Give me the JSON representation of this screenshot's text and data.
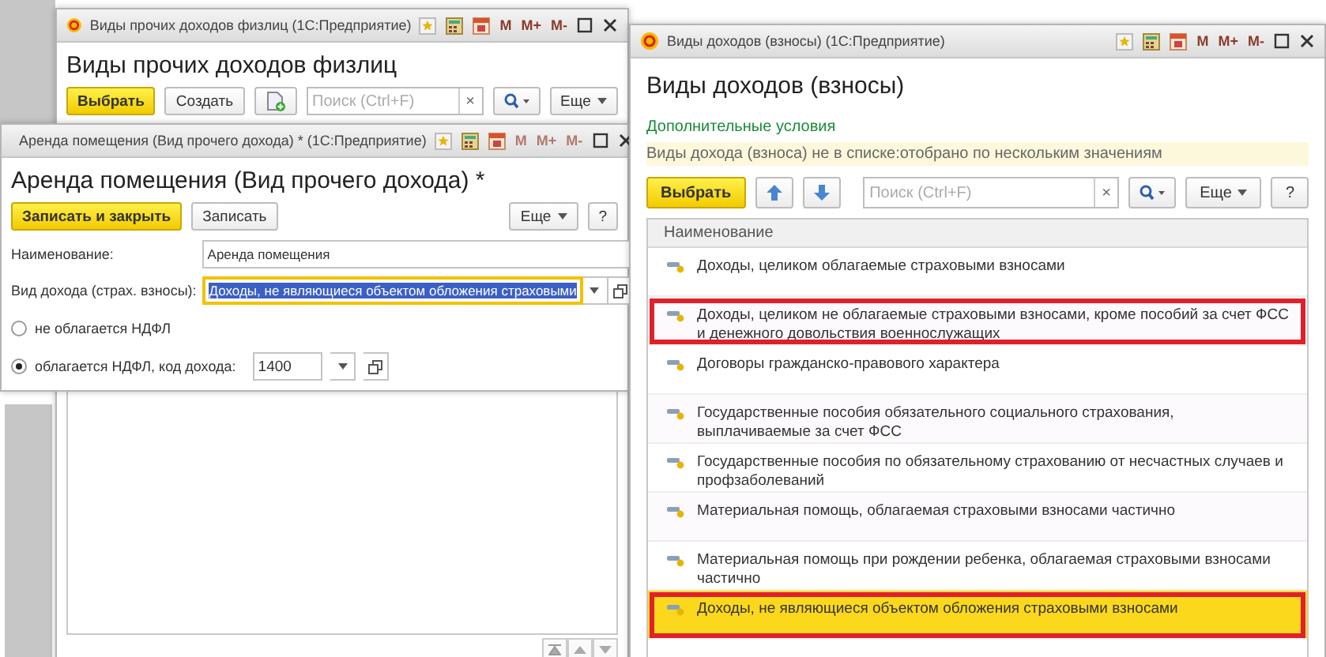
{
  "list_window": {
    "title": "Виды прочих доходов физлиц (1С:Предприятие)",
    "memory_buttons": [
      "M",
      "M+",
      "M-"
    ],
    "memory_disabled": false,
    "heading": "Виды прочих доходов физлиц",
    "select_button": "Выбрать",
    "create_button": "Создать",
    "search": {
      "placeholder": "Поиск (Ctrl+F)",
      "clear": "×"
    },
    "more_button": "Еще"
  },
  "form_window": {
    "title": "Аренда помещения (Вид прочего дохода) * (1С:Предприятие)",
    "memory_buttons": [
      "M",
      "M+",
      "M-"
    ],
    "memory_disabled": true,
    "heading": "Аренда помещения (Вид прочего дохода) *",
    "save_close_button": "Записать и закрыть",
    "save_button": "Записать",
    "more_button": "Еще",
    "help_button": "?",
    "fields": [
      {
        "label": "Наименование:",
        "value": "Аренда помещения",
        "kind": "text",
        "focused": false
      },
      {
        "label": "Вид дохода (страх. взносы):",
        "value": "Доходы, не являющиеся объектом обложения страховыми",
        "kind": "select",
        "focused": true
      }
    ],
    "ndfl_options": [
      {
        "label": "не облагается НДФЛ",
        "selected": false
      },
      {
        "label": "облагается НДФЛ, код дохода:",
        "selected": true,
        "code": "1400"
      }
    ]
  },
  "income_types_window": {
    "title": "Виды доходов (взносы) (1С:Предприятие)",
    "memory_buttons": [
      "M",
      "M+",
      "M-"
    ],
    "memory_disabled": false,
    "heading": "Виды доходов (взносы)",
    "conditions_link": "Дополнительные условия",
    "filter": "Виды дохода (взноса) не в списке:отобрано по нескольким значениям",
    "select_button": "Выбрать",
    "search": {
      "placeholder": "Поиск (Ctrl+F)",
      "clear": "×"
    },
    "more_button": "Еще",
    "help_button": "?",
    "table": {
      "columns": [
        "Наименование"
      ],
      "rows": [
        {
          "name": "Доходы, целиком облагаемые страховыми взносами",
          "selected": false,
          "outlined": false
        },
        {
          "name": "Доходы, целиком не облагаемые страховыми взносами, кроме пособий за счет ФСС и денежного довольствия военнослужащих",
          "selected": false,
          "outlined": true
        },
        {
          "name": "Договоры гражданско-правового характера",
          "selected": false,
          "outlined": false
        },
        {
          "name": "Государственные пособия обязательного социального страхования, выплачиваемые за счет ФСС",
          "selected": false,
          "outlined": false
        },
        {
          "name": "Государственные пособия по обязательному страхованию от несчастных случаев и профзаболеваний",
          "selected": false,
          "outlined": false
        },
        {
          "name": "Материальная помощь, облагаемая страховыми взносами частично",
          "selected": false,
          "outlined": false
        },
        {
          "name": "Материальная помощь при рождении ребенка, облагаемая страховыми взносами частично",
          "selected": false,
          "outlined": false
        },
        {
          "name": "Доходы, не являющиеся объектом обложения страховыми взносами",
          "selected": true,
          "outlined": true
        }
      ]
    }
  }
}
